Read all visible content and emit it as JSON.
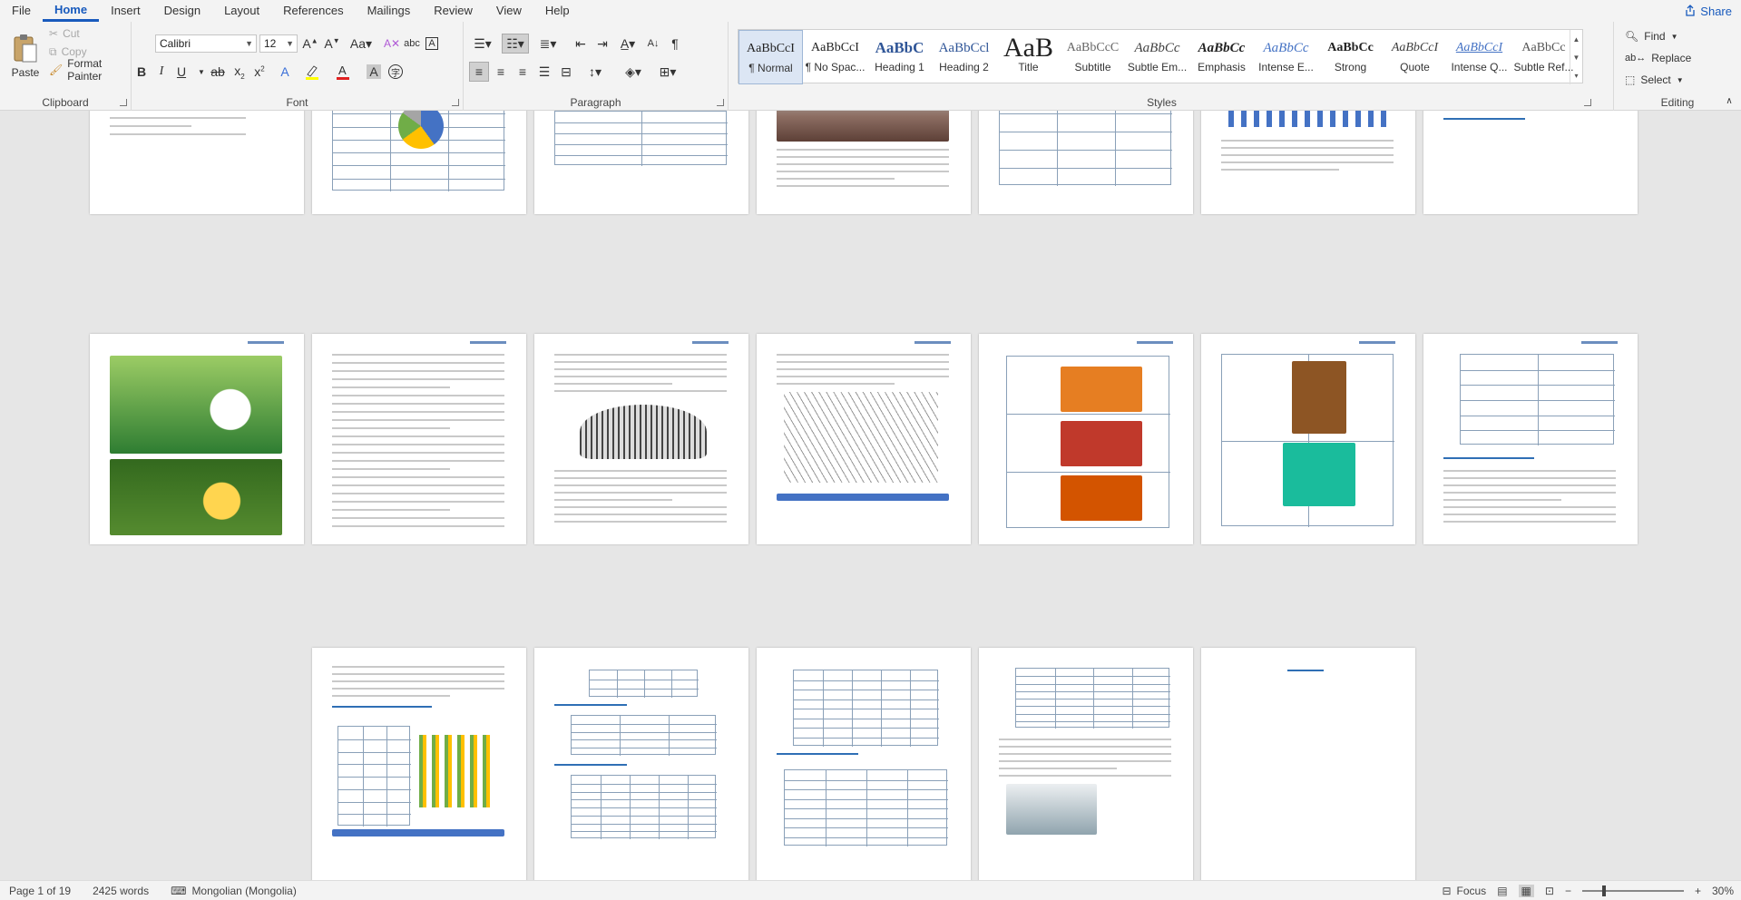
{
  "menu": {
    "tabs": [
      "File",
      "Home",
      "Insert",
      "Design",
      "Layout",
      "References",
      "Mailings",
      "Review",
      "View",
      "Help"
    ],
    "active_tab": "Home",
    "share_label": "Share"
  },
  "ribbon": {
    "clipboard": {
      "label": "Clipboard",
      "paste": "Paste",
      "cut": "Cut",
      "copy": "Copy",
      "format_painter": "Format Painter"
    },
    "font": {
      "label": "Font",
      "font_name": "Calibri",
      "font_size": "12"
    },
    "paragraph": {
      "label": "Paragraph"
    },
    "styles": {
      "label": "Styles",
      "items": [
        {
          "sample": "AaBbCcI",
          "name": "¶ Normal",
          "color": "#222222",
          "selected": true
        },
        {
          "sample": "AaBbCcI",
          "name": "¶ No Spac...",
          "color": "#222222",
          "selected": false
        },
        {
          "sample": "AaBbC",
          "name": "Heading 1",
          "color": "#2f5597",
          "selected": false
        },
        {
          "sample": "AaBbCcl",
          "name": "Heading 2",
          "color": "#2f5597",
          "selected": false
        },
        {
          "sample": "AaB",
          "name": "Title",
          "color": "#222222",
          "selected": false
        },
        {
          "sample": "AaBbCcC",
          "name": "Subtitle",
          "color": "#666666",
          "selected": false
        },
        {
          "sample": "AaBbCc",
          "name": "Subtle Em...",
          "color": "#404040",
          "selected": false
        },
        {
          "sample": "AaBbCc",
          "name": "Emphasis",
          "color": "#222222",
          "selected": false
        },
        {
          "sample": "AaBbCc",
          "name": "Intense E...",
          "color": "#4472c4",
          "selected": false
        },
        {
          "sample": "AaBbCc",
          "name": "Strong",
          "color": "#222222",
          "selected": false
        },
        {
          "sample": "AaBbCcI",
          "name": "Quote",
          "color": "#404040",
          "selected": false
        },
        {
          "sample": "AaBbCcI",
          "name": "Intense Q...",
          "color": "#4472c4",
          "selected": false
        },
        {
          "sample": "AaBbCc",
          "name": "Subtle Ref...",
          "color": "#555555",
          "selected": false
        }
      ]
    },
    "editing": {
      "label": "Editing",
      "find": "Find",
      "replace": "Replace",
      "select": "Select"
    }
  },
  "statusbar": {
    "page": "Page 1 of 19",
    "words": "2425 words",
    "language": "Mongolian (Mongolia)",
    "focus": "Focus",
    "zoom": "30%"
  }
}
